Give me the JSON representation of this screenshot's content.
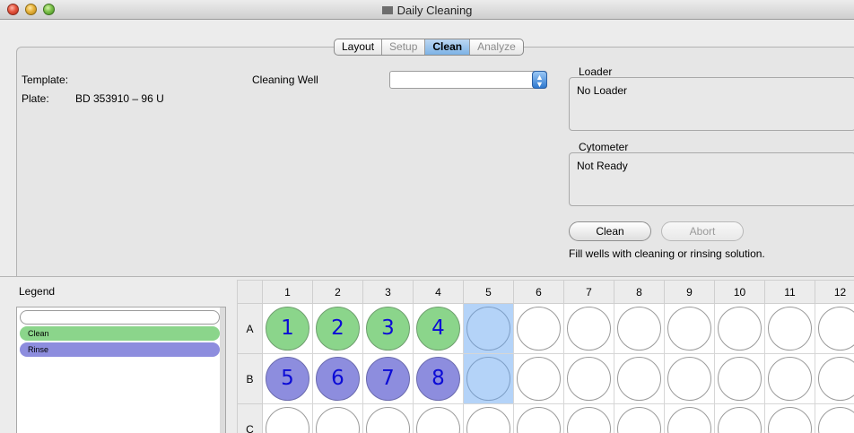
{
  "window": {
    "title": "Daily Cleaning"
  },
  "tabs": [
    {
      "label": "Layout",
      "state": "normal"
    },
    {
      "label": "Setup",
      "state": "disabled"
    },
    {
      "label": "Clean",
      "state": "active"
    },
    {
      "label": "Analyze",
      "state": "disabled"
    }
  ],
  "info": {
    "template_label": "Template:",
    "template_value": "",
    "plate_label": "Plate:",
    "plate_value": "BD 353910 – 96 U"
  },
  "cleaning_well": {
    "label": "Cleaning Well",
    "value": ""
  },
  "loader": {
    "label": "Loader",
    "value": "No Loader"
  },
  "cytometer": {
    "label": "Cytometer",
    "value": "Not Ready"
  },
  "buttons": {
    "clean": "Clean",
    "abort": "Abort"
  },
  "hint": "Fill wells with cleaning or rinsing solution.",
  "legend": {
    "title": "Legend",
    "items": [
      {
        "label": "",
        "color": "#ffffff"
      },
      {
        "label": "Clean",
        "color": "#8bd58b"
      },
      {
        "label": "Rinse",
        "color": "#8d8dde"
      }
    ]
  },
  "plate": {
    "columns": [
      "1",
      "2",
      "3",
      "4",
      "5",
      "6",
      "7",
      "8",
      "9",
      "10",
      "11",
      "12"
    ],
    "rows": [
      {
        "label": "A",
        "wells": [
          {
            "num": "1",
            "type": "clean"
          },
          {
            "num": "2",
            "type": "clean"
          },
          {
            "num": "3",
            "type": "clean"
          },
          {
            "num": "4",
            "type": "clean"
          },
          {
            "num": "",
            "type": "selected"
          },
          {
            "num": "",
            "type": "empty"
          },
          {
            "num": "",
            "type": "empty"
          },
          {
            "num": "",
            "type": "empty"
          },
          {
            "num": "",
            "type": "empty"
          },
          {
            "num": "",
            "type": "empty"
          },
          {
            "num": "",
            "type": "empty"
          },
          {
            "num": "",
            "type": "empty"
          }
        ]
      },
      {
        "label": "B",
        "wells": [
          {
            "num": "5",
            "type": "rinse"
          },
          {
            "num": "6",
            "type": "rinse"
          },
          {
            "num": "7",
            "type": "rinse"
          },
          {
            "num": "8",
            "type": "rinse"
          },
          {
            "num": "",
            "type": "selected"
          },
          {
            "num": "",
            "type": "empty"
          },
          {
            "num": "",
            "type": "empty"
          },
          {
            "num": "",
            "type": "empty"
          },
          {
            "num": "",
            "type": "empty"
          },
          {
            "num": "",
            "type": "empty"
          },
          {
            "num": "",
            "type": "empty"
          },
          {
            "num": "",
            "type": "empty"
          }
        ]
      },
      {
        "label": "C",
        "wells": [
          {
            "num": "",
            "type": "empty"
          },
          {
            "num": "",
            "type": "empty"
          },
          {
            "num": "",
            "type": "empty"
          },
          {
            "num": "",
            "type": "empty"
          },
          {
            "num": "",
            "type": "empty"
          },
          {
            "num": "",
            "type": "empty"
          },
          {
            "num": "",
            "type": "empty"
          },
          {
            "num": "",
            "type": "empty"
          },
          {
            "num": "",
            "type": "empty"
          },
          {
            "num": "",
            "type": "empty"
          },
          {
            "num": "",
            "type": "empty"
          },
          {
            "num": "",
            "type": "empty"
          }
        ]
      }
    ]
  }
}
